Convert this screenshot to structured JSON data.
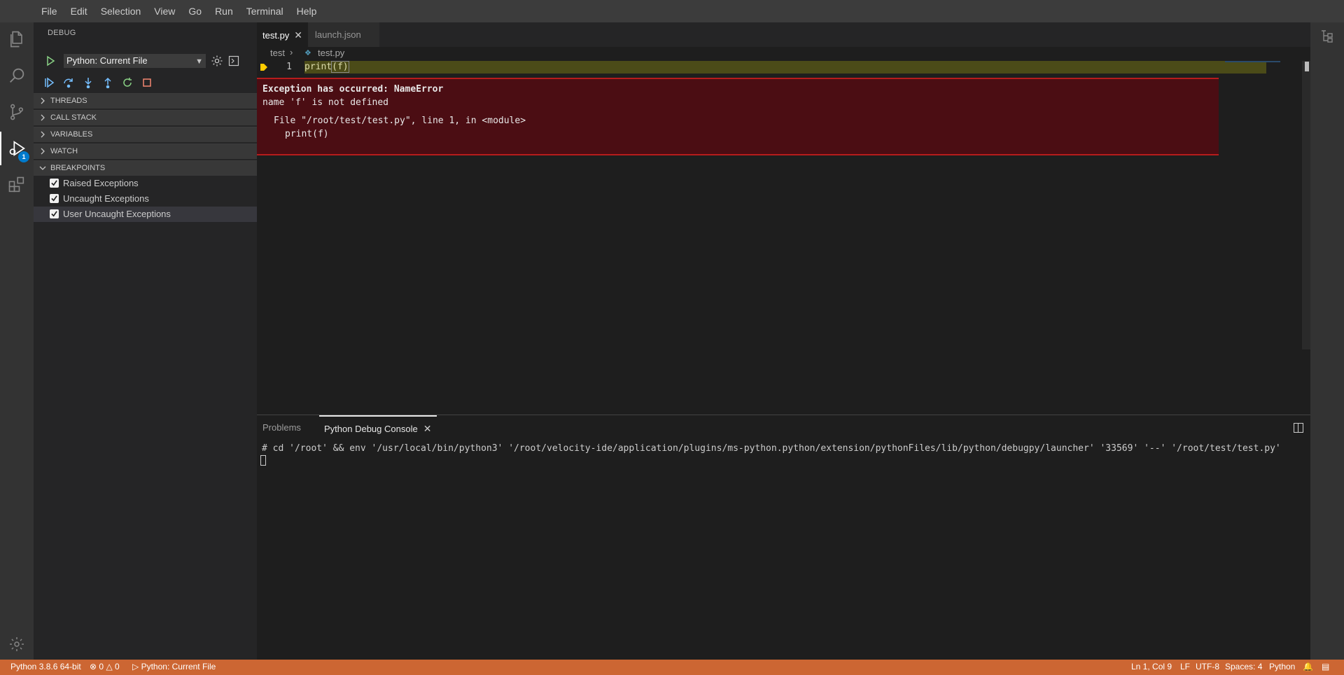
{
  "menu": [
    "File",
    "Edit",
    "Selection",
    "View",
    "Go",
    "Run",
    "Terminal",
    "Help"
  ],
  "activity": {
    "debug_badge": "1"
  },
  "sidebar": {
    "title": "DEBUG",
    "config_select": "Python: Current File",
    "sections": [
      "THREADS",
      "CALL STACK",
      "VARIABLES",
      "WATCH",
      "BREAKPOINTS"
    ],
    "breakpoints": [
      {
        "label": "Raised Exceptions",
        "checked": true
      },
      {
        "label": "Uncaught Exceptions",
        "checked": true
      },
      {
        "label": "User Uncaught Exceptions",
        "checked": true
      }
    ]
  },
  "tabs": [
    {
      "label": "test.py",
      "active": true
    },
    {
      "label": "launch.json",
      "active": false
    }
  ],
  "breadcrumb": {
    "folder": "test",
    "file": "test.py"
  },
  "editor": {
    "line_number": "1",
    "code_prefix": "print",
    "code_paren": "(f)",
    "exception_title": "Exception has occurred: NameError",
    "exception_message": "name 'f' is not defined",
    "trace_line1": "File \"/root/test/test.py\", line 1, in <module>",
    "trace_line2": "print(f)"
  },
  "panel": {
    "tabs": [
      "Problems",
      "Python Debug Console"
    ],
    "console_line": "# cd '/root' && env '/usr/local/bin/python3' '/root/velocity-ide/application/plugins/ms-python.python/extension/pythonFiles/lib/python/debugpy/launcher' '33569' '--' '/root/test/test.py'"
  },
  "status": {
    "interpreter": "Python 3.8.6 64-bit",
    "errors": "0",
    "warnings": "0",
    "debug_config": "Python: Current File",
    "position": "Ln 1, Col 9",
    "eol": "LF",
    "encoding": "UTF-8",
    "indent": "Spaces: 4",
    "language": "Python"
  },
  "colors": {
    "statusbar": "#cc6633",
    "exception_bg": "#4b0d13",
    "line_highlight": "#4b4b18",
    "accent": "#007acc"
  }
}
